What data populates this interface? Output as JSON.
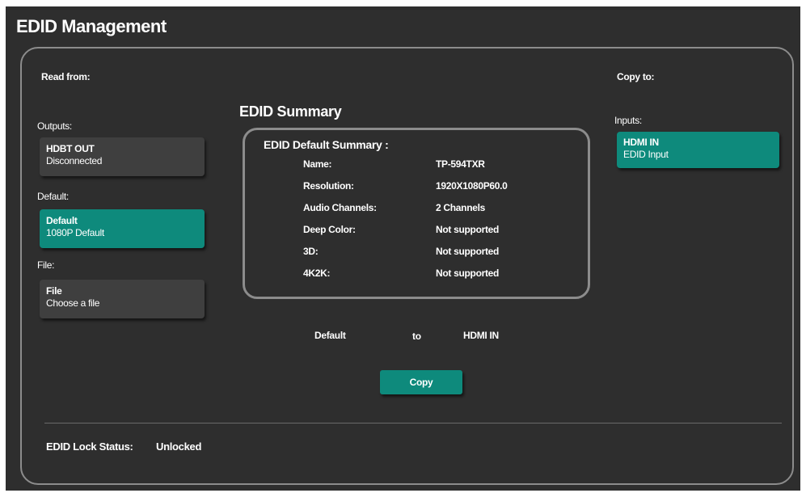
{
  "page": {
    "title": "EDID Management"
  },
  "read_from": {
    "heading": "Read from:",
    "outputs_label": "Outputs:",
    "output_tile": {
      "name": "HDBT OUT",
      "status": "Disconnected"
    },
    "default_label": "Default:",
    "default_tile": {
      "name": "Default",
      "detail": "1080P Default"
    },
    "file_label": "File:",
    "file_tile": {
      "name": "File",
      "detail": "Choose a file"
    }
  },
  "summary": {
    "title": "EDID Summary",
    "box_heading": "EDID Default Summary :",
    "rows": [
      {
        "key": "Name:",
        "value": "TP-594TXR"
      },
      {
        "key": "Resolution:",
        "value": "1920X1080P60.0"
      },
      {
        "key": "Audio Channels:",
        "value": "2 Channels"
      },
      {
        "key": "Deep Color:",
        "value": "Not supported"
      },
      {
        "key": "3D:",
        "value": "Not supported"
      },
      {
        "key": "4K2K:",
        "value": "Not supported"
      }
    ]
  },
  "copy_to": {
    "heading": "Copy to:",
    "inputs_label": "Inputs:",
    "input_tile": {
      "name": "HDMI IN",
      "detail": "EDID Input"
    }
  },
  "copy_action": {
    "source": "Default",
    "to_word": "to",
    "target": "HDMI IN",
    "button_label": "Copy"
  },
  "lock": {
    "label": "EDID Lock Status:",
    "value": "Unlocked"
  },
  "colors": {
    "background": "#2e2e2e",
    "accent": "#0e8a7c",
    "tile": "#3f3f3f",
    "border": "#8c8c8c"
  }
}
